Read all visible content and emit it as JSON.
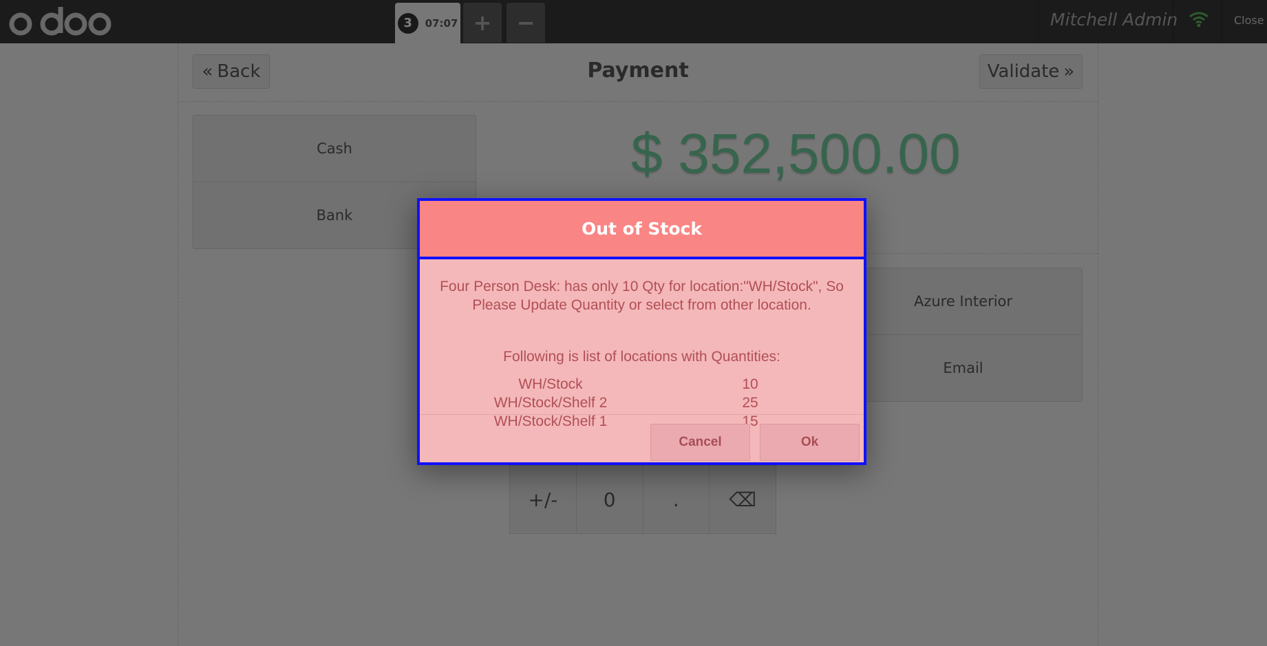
{
  "topbar": {
    "logo_text": "odoo",
    "order": {
      "number": "3",
      "time": "07:07"
    },
    "add_order_label": "+",
    "remove_order_label": "−",
    "user_name": "Mitchell Admin",
    "close_label": "Close",
    "wifi_color": "#5cb85c"
  },
  "payment": {
    "back_label": "Back",
    "title": "Payment",
    "validate_label": "Validate",
    "methods": [
      "Cash",
      "Bank"
    ],
    "total": "$ 352,500.00",
    "customer": "Azure Interior",
    "email_label": "Email",
    "numpad": [
      "+/-",
      "0",
      ".",
      "⌫"
    ]
  },
  "modal": {
    "title": "Out of Stock",
    "message": "Four Person Desk: has only 10 Qty for location:\"WH/Stock\", So Please Update Quantity or select from other location.",
    "subtitle": "Following is list of locations with Quantities:",
    "locations": [
      {
        "name": "WH/Stock",
        "qty": "10"
      },
      {
        "name": "WH/Stock/Shelf 2",
        "qty": "25"
      },
      {
        "name": "WH/Stock/Shelf 1",
        "qty": "15"
      }
    ],
    "cancel_label": "Cancel",
    "ok_label": "Ok"
  },
  "colors": {
    "modal_header": "#fa8585",
    "modal_body": "#f4b8ba",
    "highlight_border": "#1010ff",
    "total": "#6ec89b"
  }
}
